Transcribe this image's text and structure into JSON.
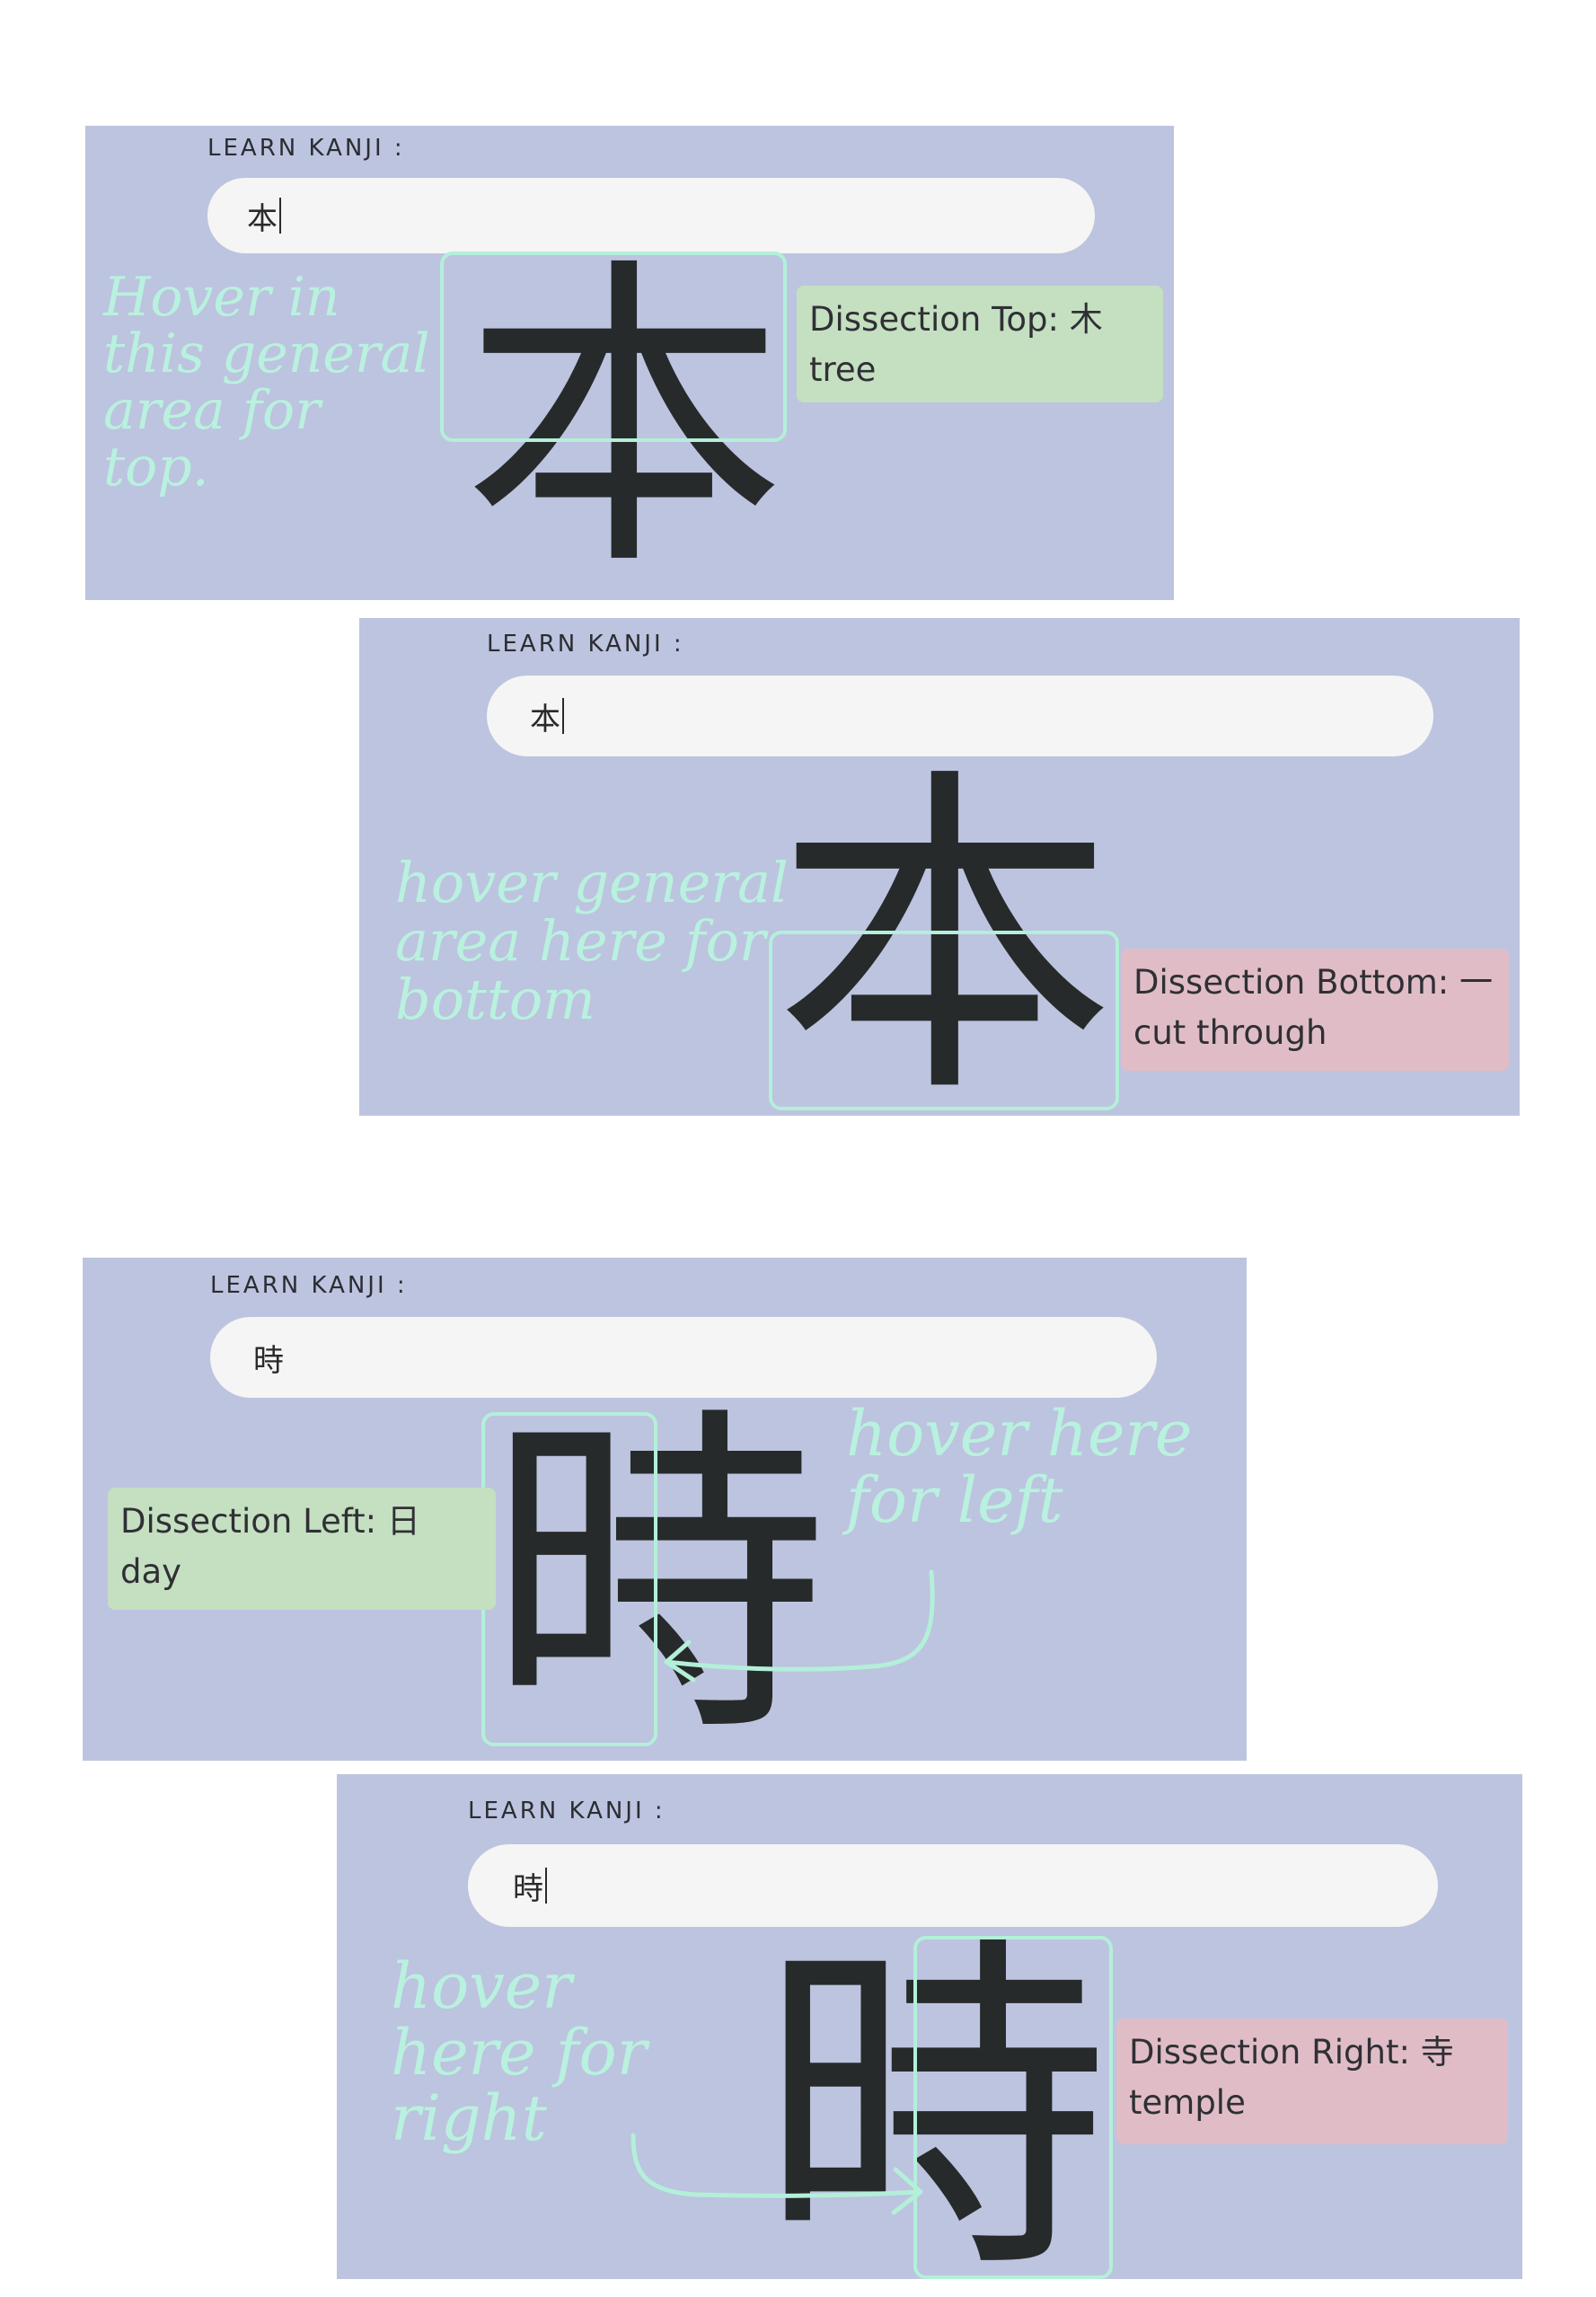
{
  "label_text": "LEARN KANJI :",
  "panels": [
    {
      "input_value": "本",
      "kanji": "本",
      "tooltip": {
        "line1": "Dissection Top: 木",
        "line2": "tree"
      },
      "note": "Hover in\nthis general\narea for\ntop."
    },
    {
      "input_value": "本",
      "kanji": "本",
      "tooltip": {
        "line1": "Dissection Bottom: 一",
        "line2": "cut through"
      },
      "note": "hover general\narea here for\nbottom"
    },
    {
      "input_value": "時",
      "kanji": "時",
      "tooltip": {
        "line1": "Dissection Left: 日",
        "line2": "day"
      },
      "note": "hover here\nfor left"
    },
    {
      "input_value": "時",
      "kanji": "時",
      "tooltip": {
        "line1": "Dissection Right: 寺",
        "line2": "temple"
      },
      "note": "hover\nhere for\nright"
    }
  ],
  "colors": {
    "panel": "#bdc4df",
    "input": "#f5f5f5",
    "tooltip_green": "#c5dfc1",
    "tooltip_pink": "#e0bdc6",
    "annotation": "#b9f1df"
  }
}
